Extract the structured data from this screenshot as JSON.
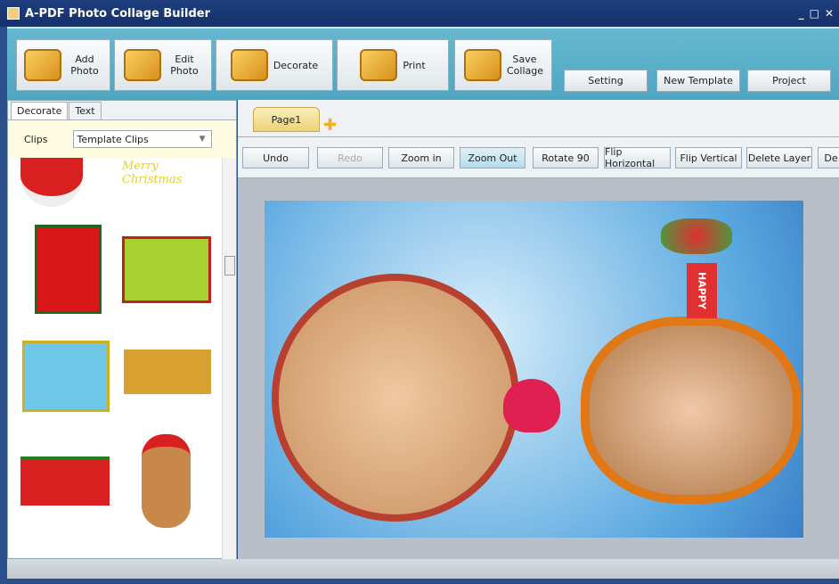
{
  "window": {
    "title": "A-PDF Photo Collage Builder",
    "controls": [
      "_",
      "□",
      "✕"
    ]
  },
  "ribbon": {
    "buttons": [
      {
        "label": "Add Photo",
        "icon": "add-photo-icon"
      },
      {
        "label": "Edit Photo",
        "icon": "edit-photo-icon"
      },
      {
        "label": "Decorate",
        "icon": "decorate-icon"
      },
      {
        "label": "Print",
        "icon": "printer-icon"
      },
      {
        "label": "Save Collage",
        "icon": "save-icon"
      }
    ],
    "small": [
      "Setting",
      "New Template",
      "Project"
    ]
  },
  "left": {
    "tabs": [
      "Decorate",
      "Text"
    ],
    "clips_label": "Clips",
    "clips_value": "Template Clips",
    "banner_text": "Merry Christmas"
  },
  "pages": {
    "tabs": [
      "Page1"
    ]
  },
  "toolbar": [
    "Undo",
    "Redo",
    "Zoom in",
    "Zoom Out",
    "Rotate 90",
    "Flip Horizontal",
    "Flip Vertical",
    "Delete Layer",
    "De"
  ],
  "canvas": {
    "happy_text": "HAPPY"
  }
}
